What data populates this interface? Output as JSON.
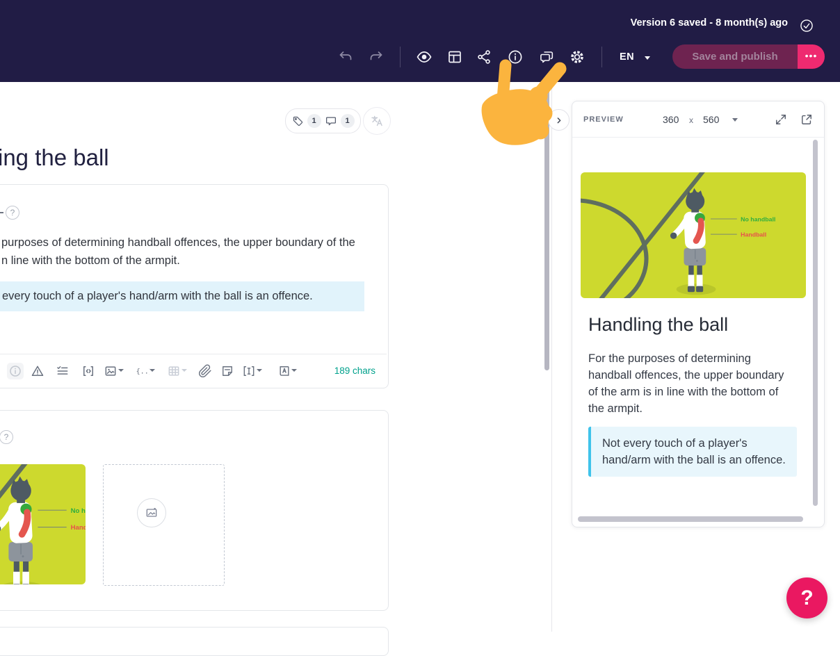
{
  "topbar": {
    "version_status": "Version 6 saved - 8 month(s) ago",
    "language": "EN",
    "save_button_label": "Save and publish",
    "more_button_label": "•••",
    "icons": [
      "undo",
      "redo",
      "preview-eye",
      "layout-template",
      "share",
      "info",
      "comments",
      "settings-gear",
      "version-check"
    ]
  },
  "badges": {
    "tag_count": "1",
    "comment_count": "1"
  },
  "editor": {
    "title_fragment": "ing the ball",
    "text_block": {
      "line1_fragment": "purposes of determining handball offences, the upper boundary of the",
      "line2_fragment": "n line with the bottom of the armpit.",
      "highlight_fragment": "every touch of a player's hand/arm with the ball is an offence.",
      "char_count": "189 chars"
    },
    "toolbar_icons": [
      "info",
      "warning",
      "checklist",
      "code-block",
      "image",
      "variables",
      "table",
      "attachment",
      "note",
      "text-section",
      "glossary"
    ]
  },
  "preview": {
    "panel_label": "PREVIEW",
    "size_width": "360",
    "size_separator": "x",
    "size_height": "560",
    "icons": [
      "expand",
      "open-external"
    ],
    "slide": {
      "title": "Handling the ball",
      "body": "For the purposes of determining handball offences, the upper boundary of the arm is in line with the bottom of the armpit.",
      "callout": "Not every touch of a player's hand/arm with the ball is an offence."
    }
  },
  "illustration": {
    "no_handball_label": "No handball",
    "handball_label": "Handball"
  },
  "glyphs": {
    "question": "?"
  },
  "help_button_label": "?",
  "colors": {
    "topbar_bg": "#211c45",
    "accent_pink": "#ee2a70",
    "save_disabled_bg": "#6e2350",
    "highlight_blue": "#e1f3fb",
    "callout_bg": "#e8f6fc",
    "callout_border": "#3fc3eb",
    "char_count_teal": "#00a18c",
    "hand_yellow": "#fbb43e",
    "illustration_bg": "#cdd92e",
    "no_handball_green": "#2fae3f",
    "handball_red": "#e8504b",
    "help_fab_pink": "#ea1861"
  }
}
